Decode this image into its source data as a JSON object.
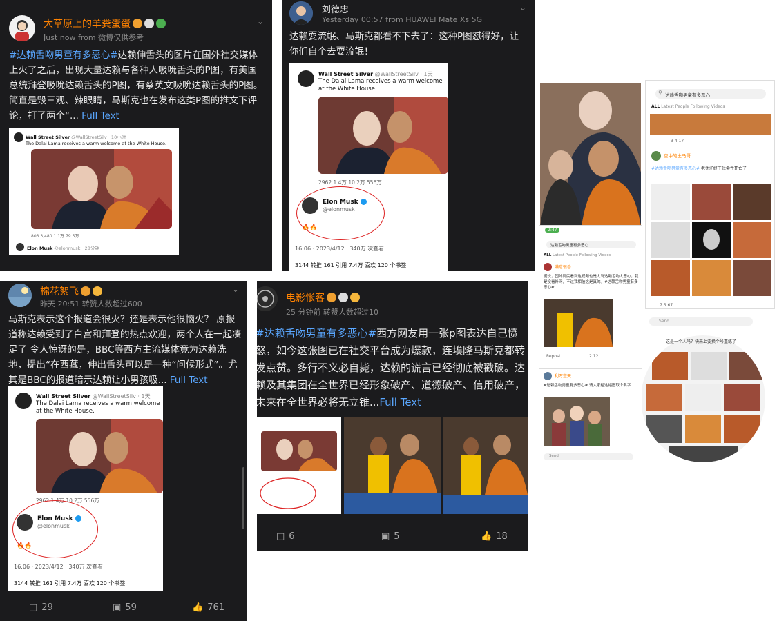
{
  "post1": {
    "username": "大草原上的羊粪蛋蛋",
    "time": "Just now",
    "source": "from 微博仅供参考",
    "hashtag": "#达赖舌吻男童有多恶心#",
    "text": "达赖伸舌头的图片在国外社交媒体上火了之后，出现大量达赖与各种人吸吮舌头的P图，有美国总统拜登吸吮达赖舌头的P图，有蔡英文吸吮达赖舌头的P图。简直是毁三观、辣眼睛，马斯克也在发布这类P图的推文下评论，打了两个“...",
    "full_text": "Full Text",
    "tweet_author": "Wall Street Silver",
    "tweet_handle": "@WallStreetSilv · 10小时",
    "tweet_text": "The Dalai Lama receives a warm welcome at the White House.",
    "tweet_stats": [
      "803",
      "3,480",
      "1.1万",
      "79.5万"
    ],
    "reply_author": "Elon Musk",
    "reply_handle": "@elonmusk · 28分钟"
  },
  "post2": {
    "username": "刘德忠",
    "time": "Yesterday 00:57",
    "source": "from HUAWEI Mate Xs 5G",
    "text": "达赖耍流氓、马斯克都看不下去了：这种P图怼得好，让你们自个去耍流氓！",
    "tweet_author": "Wall Street Silver",
    "tweet_handle": "@WallStreetSilv · 1天",
    "tweet_text": "The Dalai Lama receives a warm welcome at the White House.",
    "tweet_stats": [
      "2962",
      "1.4万",
      "10.2万",
      "556万"
    ],
    "reply_author": "Elon Musk",
    "reply_handle": "@elonmusk",
    "emoji": "🔥🔥",
    "datetime": "16:06 · 2023/4/12 · 340万 次查看",
    "counts": "3144 转推   161 引用   7.4万 喜欢   120 个书签"
  },
  "post3": {
    "username": "棉花絮飞",
    "time": "昨天 20:51",
    "source": "转赞人数超过600",
    "text": "马斯克表示这个报道会很火？还是表示他很恼火？ 原报道称达赖受到了白宫和拜登的热点欢迎，两个人在一起凑足了 令人惊讶的是，BBC等西方主流媒体竟为达赖洗地，提出“在西藏，伸出舌头可以是一种“问候形式”。尤其是BBC的报道暗示达赖让小男孩吸...",
    "full_text": "Full Text",
    "tweet_author": "Wall Street Silver",
    "tweet_handle": "@WallStreetSilv · 1天",
    "tweet_text": "The Dalai Lama receives a warm welcome at the White House.",
    "tweet_stats": [
      "2962",
      "1.4万",
      "10.2万",
      "556万"
    ],
    "reply_author": "Elon Musk",
    "reply_handle": "@elonmusk",
    "emoji": "🔥🔥",
    "datetime": "16:06 · 2023/4/12 · 340万 次查看",
    "counts": "3144 转推   161 引用   7.4万 喜欢   120 个书签",
    "actions": [
      "29",
      "59",
      "761"
    ]
  },
  "post4": {
    "username": "电影怅客",
    "time": "25 分钟前",
    "source": "转赞人数超过10",
    "hashtag": "#达赖舌吻男童有多恶心#",
    "text": "西方网友用一张p图表达自己愤怒，如今这张图已在社交平台成为爆款，连埃隆马斯克都转发点赞。多行不义必自毙，达赖的谎言已经彻底被戳破。达赖及其集团在全世界已经形象破产、道德破产、信用破产，未来在全世界必将无立锥...",
    "full_text": "Full Text",
    "actions": [
      "6",
      "5",
      "18"
    ]
  },
  "collage": {
    "search_query": "达赖舌吻男童有多恶心",
    "tabs": [
      "ALL",
      "Latest",
      "People",
      "Following",
      "Videos"
    ],
    "send_label": "Send",
    "repost_label": "Repost",
    "user_a": "空中的土马哥",
    "hashtag_a": "#达赖舌吻男童有多恶心#",
    "text_a": "老秃驴终于社会性死亡了",
    "user_b": "满意很香",
    "text_b": "据说，国外网民看到这视频也是大骂达赖舌吻大恶心，我是没看外网，不过我相信这是真的。#达赖舌吻男童有多恶心#",
    "user_c": "利万空天",
    "text_c": "#达赖舌吻男童有多恶心# 请大家给这幅图取个名字",
    "circle_caption": "这是一个人吗？快来上要换个号重练了",
    "time_badge": "2:47",
    "counts_a": [
      "3",
      "4",
      "17"
    ],
    "counts_b": [
      "2",
      "12"
    ],
    "counts_c": [
      "7",
      "5",
      "67"
    ]
  }
}
